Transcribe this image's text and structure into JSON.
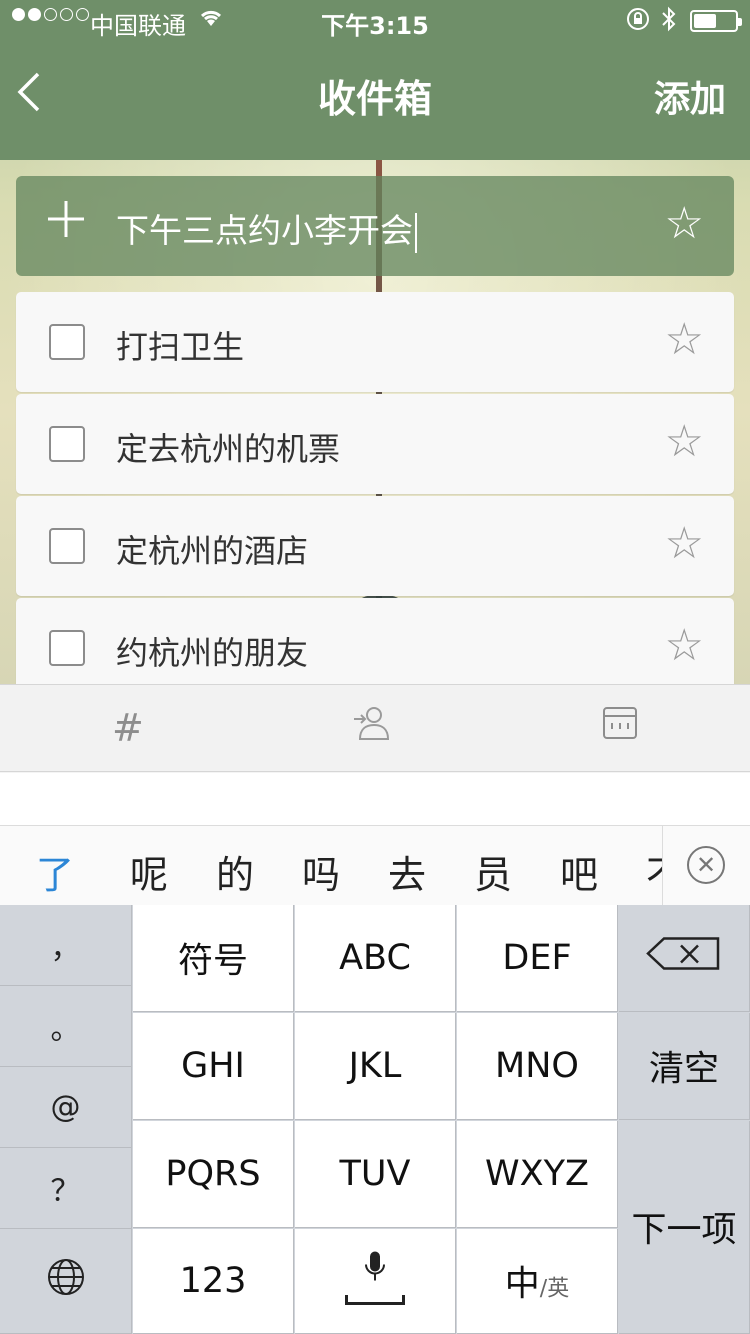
{
  "status": {
    "carrier": "中国联通",
    "time": "下午3:15",
    "signal_bars_filled": 2,
    "signal_bars_total": 5,
    "battery_level": 0.55
  },
  "nav": {
    "back_icon": "chevron-left-icon",
    "title": "收件箱",
    "add_label": "添加"
  },
  "new_task": {
    "plus_symbol": "+",
    "value": "下午三点约小李开会"
  },
  "tasks": [
    {
      "label": "打扫卫生"
    },
    {
      "label": "定去杭州的机票"
    },
    {
      "label": "定杭州的酒店"
    },
    {
      "label": "约杭州的朋友"
    }
  ],
  "toolbar": {
    "hash_icon": "#"
  },
  "candidates": [
    "了",
    "呢",
    "的",
    "吗",
    "去",
    "员",
    "吧",
    "不"
  ],
  "keyboard": {
    "punctuation": [
      "，",
      "。",
      "@",
      "？"
    ],
    "rows": [
      [
        "符号",
        "ABC",
        "DEF"
      ],
      [
        "GHI",
        "JKL",
        "MNO"
      ],
      [
        "PQRS",
        "TUV",
        "WXYZ"
      ],
      [
        "123",
        "",
        "中"
      ]
    ],
    "zh_en_small": "/英",
    "clear_label": "清空",
    "next_label": "下一项"
  },
  "colors": {
    "header": "#6f8f69",
    "candidate_highlight": "#2c86d6"
  }
}
